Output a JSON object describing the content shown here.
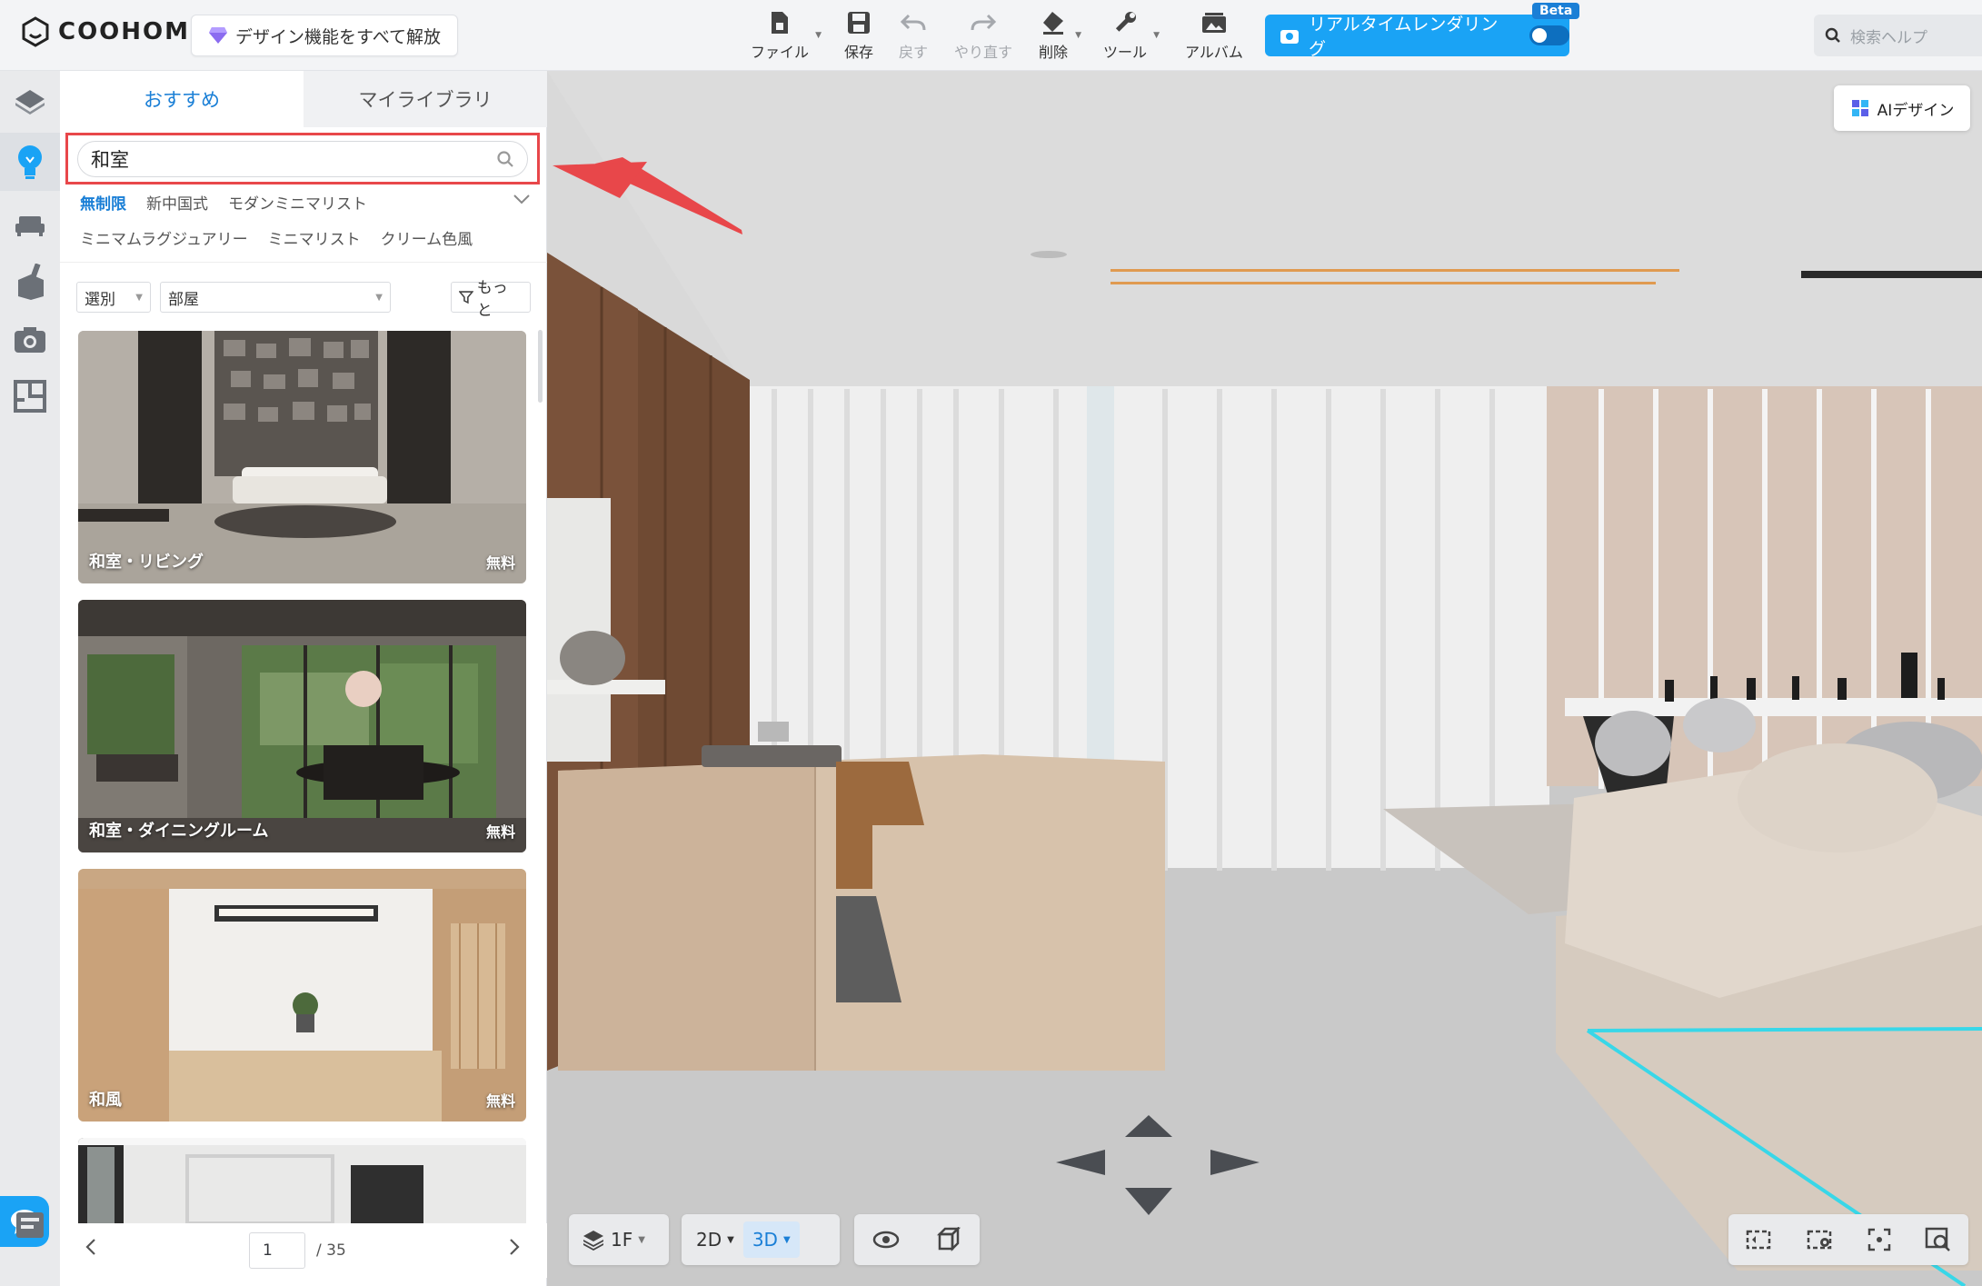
{
  "app": {
    "logo_text": "COOHOM"
  },
  "unlock": {
    "label": "デザイン機能をすべて解放"
  },
  "toolbar": {
    "file": "ファイル",
    "save": "保存",
    "undo": "戻す",
    "redo": "やり直す",
    "delete": "削除",
    "tools": "ツール",
    "album": "アルバム"
  },
  "render": {
    "label": "リアルタイムレンダリング",
    "badge": "Beta"
  },
  "help_search": {
    "placeholder": "検索ヘルプ"
  },
  "panel": {
    "tabs": [
      "おすすめ",
      "マイライブラリ"
    ],
    "search_value": "和室",
    "tags_row1": [
      "無制限",
      "新中国式",
      "モダンミニマリスト"
    ],
    "tags_row2": [
      "ミニマムラグジュアリー",
      "ミニマリスト",
      "クリーム色風"
    ],
    "filter_select": "選別",
    "room_select": "部屋",
    "more_button": "もっと",
    "cards": [
      {
        "label": "和室・リビング",
        "price": "無料"
      },
      {
        "label": "和室・ダイニングルーム",
        "price": "無料"
      },
      {
        "label": "和風",
        "price": "無料"
      }
    ],
    "pager": {
      "current": "1",
      "total": "/ 35"
    }
  },
  "viewport": {
    "ai_button": "AIデザイン",
    "floor": "1F",
    "view_2d": "2D",
    "view_3d": "3D"
  }
}
